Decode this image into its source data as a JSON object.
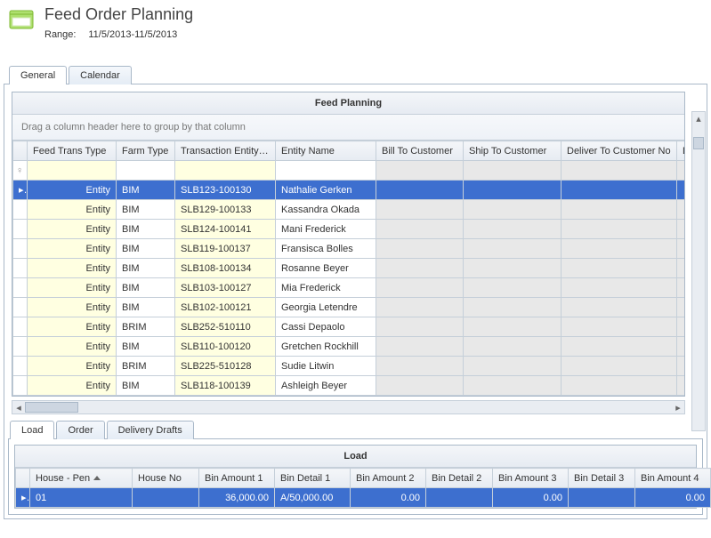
{
  "header": {
    "title": "Feed Order Planning",
    "range_label": "Range:",
    "range_value": "11/5/2013-11/5/2013"
  },
  "tabs": {
    "general": "General",
    "calendar": "Calendar"
  },
  "grid1": {
    "title": "Feed Planning",
    "group_hint": "Drag a column header here to group by that column",
    "cols": [
      "Feed Trans Type",
      "Farm Type",
      "Transaction Entity ID",
      "Entity Name",
      "Bill To Customer",
      "Ship To Customer",
      "Deliver To Customer No",
      "Deliver T"
    ],
    "rows": [
      {
        "ftt": "Entity",
        "farm": "BIM",
        "trans": "SLB123-100130",
        "name": "Nathalie Gerken",
        "selected": true
      },
      {
        "ftt": "Entity",
        "farm": "BIM",
        "trans": "SLB129-100133",
        "name": "Kassandra Okada"
      },
      {
        "ftt": "Entity",
        "farm": "BIM",
        "trans": "SLB124-100141",
        "name": "Mani Frederick"
      },
      {
        "ftt": "Entity",
        "farm": "BIM",
        "trans": "SLB119-100137",
        "name": "Fransisca Bolles"
      },
      {
        "ftt": "Entity",
        "farm": "BIM",
        "trans": "SLB108-100134",
        "name": "Rosanne Beyer"
      },
      {
        "ftt": "Entity",
        "farm": "BIM",
        "trans": "SLB103-100127",
        "name": "Mia Frederick"
      },
      {
        "ftt": "Entity",
        "farm": "BIM",
        "trans": "SLB102-100121",
        "name": "Georgia Letendre"
      },
      {
        "ftt": "Entity",
        "farm": "BRIM",
        "trans": "SLB252-510110",
        "name": "Cassi Depaolo"
      },
      {
        "ftt": "Entity",
        "farm": "BIM",
        "trans": "SLB110-100120",
        "name": "Gretchen Rockhill"
      },
      {
        "ftt": "Entity",
        "farm": "BRIM",
        "trans": "SLB225-510128",
        "name": "Sudie Litwin"
      },
      {
        "ftt": "Entity",
        "farm": "BIM",
        "trans": "SLB118-100139",
        "name": "Ashleigh Beyer"
      }
    ]
  },
  "tabs2": {
    "load": "Load",
    "order": "Order",
    "drafts": "Delivery Drafts"
  },
  "grid2": {
    "title": "Load",
    "cols": [
      "House - Pen",
      "House No",
      "Bin Amount 1",
      "Bin Detail 1",
      "Bin Amount 2",
      "Bin Detail 2",
      "Bin Amount 3",
      "Bin Detail 3",
      "Bin Amount 4"
    ],
    "rows": [
      {
        "hp": "01",
        "hn": "",
        "a1": "36,000.00",
        "d1": "A/50,000.00",
        "a2": "0.00",
        "d2": "",
        "a3": "0.00",
        "d3": "",
        "a4": "0.00",
        "selected": true
      }
    ]
  }
}
